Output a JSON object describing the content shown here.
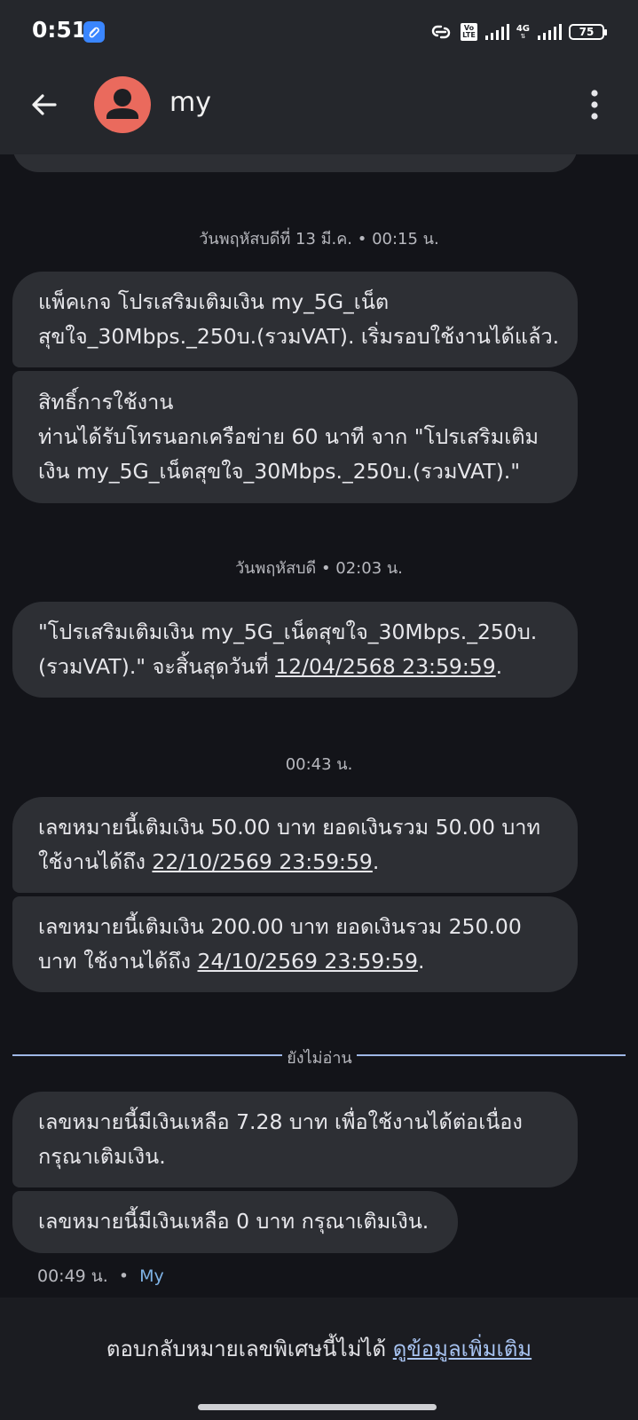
{
  "status": {
    "time": "0:51",
    "volte": "Vo\nLTE",
    "network": "4G",
    "battery": "75"
  },
  "header": {
    "contact_name": "my",
    "back_icon": "arrow-left-icon",
    "menu_icon": "more-vert-icon"
  },
  "dates": {
    "d1": "วันพฤหัสบดีที่ 13 มี.ค.  •  00:15 น.",
    "d2": "วันพฤหัสบดี  •  02:03 น.",
    "d3": "00:43 น."
  },
  "messages": {
    "m1": {
      "text": "แพ็คเกจ โปรเสริมเติมเงิน my_5G_เน็ต\nสุขใจ_30Mbps._250บ.(รวมVAT). เริ่มรอบใช้งานได้แล้ว."
    },
    "m2": {
      "text": "สิทธิ์การใช้งาน\nท่านได้รับโทรนอกเครือข่าย 60 นาที  จาก \"โปรเสริมเติม\nเงิน my_5G_เน็ตสุขใจ_30Mbps._250บ.(รวมVAT).\""
    },
    "m3": {
      "pre": "\"โปรเสริมเติมเงิน my_5G_เน็ตสุขใจ_30Mbps._250บ.\n(รวมVAT).\" จะสิ้นสุดวันที่ ",
      "link": "12/04/2568 23:59:59",
      "post": "."
    },
    "m4": {
      "pre": "เลขหมายนี้เติมเงิน 50.00 บาท ยอดเงินรวม 50.00  บาท\nใช้งานได้ถึง ",
      "link": "22/10/2569 23:59:59",
      "post": "."
    },
    "m5": {
      "pre": "เลขหมายนี้เติมเงิน 200.00 บาท ยอดเงินรวม 250.00\nบาท ใช้งานได้ถึง ",
      "link": "24/10/2569 23:59:59",
      "post": "."
    },
    "m6": {
      "text": "เลขหมายนี้มีเงินเหลือ 7.28 บาท  เพื่อใช้งานได้ต่อเนื่อง\nกรุณาเติมเงิน."
    },
    "m7": {
      "text": "เลขหมายนี้มีเงินเหลือ 0 บาท กรุณาเติมเงิน."
    }
  },
  "unread_label": "ยังไม่อ่าน",
  "last_meta": {
    "time": "00:49 น.",
    "sep": "•",
    "sender": "My"
  },
  "footer": {
    "text": "ตอบกลับหมายเลขพิเศษนี้ไม่ได้ ",
    "link": "ดูข้อมูลเพิ่มเติม"
  }
}
